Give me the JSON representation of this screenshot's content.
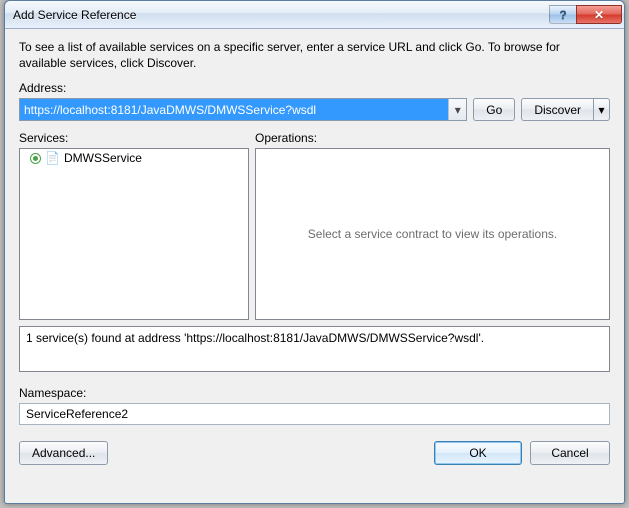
{
  "window": {
    "title": "Add Service Reference"
  },
  "controls": {
    "help": "?",
    "close": "✕"
  },
  "intro": "To see a list of available services on a specific server, enter a service URL and click Go. To browse for available services, click Discover.",
  "address": {
    "label": "Address:",
    "value": "https://localhost:8181/JavaDMWS/DMWSService?wsdl",
    "go_label": "Go",
    "discover_label": "Discover"
  },
  "services": {
    "label": "Services:",
    "items": [
      {
        "name": "DMWSService"
      }
    ]
  },
  "operations": {
    "label": "Operations:",
    "placeholder": "Select a service contract to view its operations."
  },
  "status": "1 service(s) found at address 'https://localhost:8181/JavaDMWS/DMWSService?wsdl'.",
  "namespace": {
    "label": "Namespace:",
    "value": "ServiceReference2"
  },
  "buttons": {
    "advanced": "Advanced...",
    "ok": "OK",
    "cancel": "Cancel"
  }
}
